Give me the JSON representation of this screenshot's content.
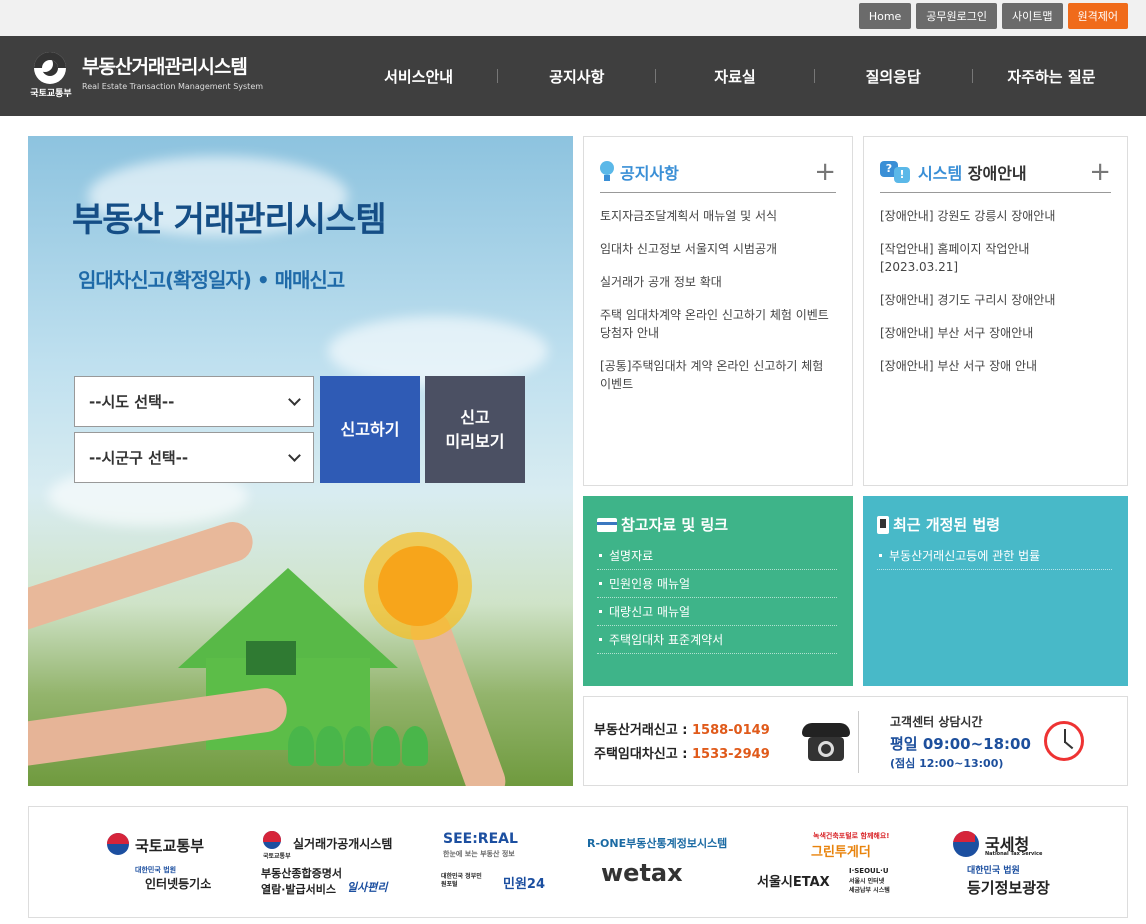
{
  "util_bar": {
    "home": "Home",
    "official_login": "공무원로그인",
    "sitemap": "사이트맵",
    "remote_control": "원격제어"
  },
  "header": {
    "ministry": "국토교통부",
    "title_ko": "부동산거래관리시스템",
    "title_en": "Real Estate Transaction Management System",
    "nav": [
      "서비스안내",
      "공지사항",
      "자료실",
      "질의응답",
      "자주하는 질문"
    ]
  },
  "hero": {
    "title": "부동산 거래관리시스템",
    "subtitle": "임대차신고(확정일자) • 매매신고",
    "sido_select": "--시도 선택--",
    "sigungu_select": "--시군구 선택--",
    "report_button": "신고하기",
    "preview_button": "신고\n미리보기"
  },
  "notice": {
    "title": "공지사항",
    "plus": "+",
    "items": [
      "토지자금조달계획서 매뉴얼 및 서식",
      "임대차 신고정보 서울지역 시범공개",
      "실거래가 공개 정보 확대",
      "주택 임대차계약 온라인 신고하기 체험 이벤트 당첨자 안내",
      "[공통]주택임대차 계약 온라인 신고하기 체험 이벤트"
    ]
  },
  "outage": {
    "title_a": "시스템",
    "title_b": "장애안내",
    "plus": "+",
    "items": [
      "[장애안내] 강원도 강릉시 장애안내",
      "[작업안내] 홈페이지 작업안내 [2023.03.21]",
      "[장애안내] 경기도 구리시 장애안내",
      "[장애안내] 부산 서구 장애안내",
      "[장애안내] 부산 서구 장애 안내"
    ]
  },
  "references": {
    "title": "참고자료 및 링크",
    "items": [
      "설명자료",
      "민원인용 매뉴얼",
      "대량신고 매뉴얼",
      "주택임대차 표준계약서"
    ]
  },
  "laws": {
    "title": "최근 개정된 법령",
    "items": [
      "부동산거래신고등에 관한 법률"
    ]
  },
  "contact": {
    "sale_label": "부동산거래신고 :",
    "sale_number": "1588-0149",
    "lease_label": "주택임대차신고 :",
    "lease_number": "1533-2949",
    "hours_title": "고객센터 상담시간",
    "hours": "평일 09:00~18:00",
    "lunch": "(점심 12:00~13:00)"
  },
  "banners": {
    "molit": "국토교통부",
    "iros": "인터넷등기소",
    "iros_sub": "대한민국 법원",
    "rtms": "실거래가공개시스템",
    "rtms_sub": "국토교통부",
    "cert_line1": "부동산종합증명서",
    "cert_line2": "열람·발급서비스",
    "cert_brand": "일사편리",
    "seereal": "SEE:REAL",
    "seereal_sub": "한눈에 보는 부동산 정보",
    "minwon_sub": "대한민국 정부민원포털",
    "minwon": "민원24",
    "rone": "R-ONE부동산통계정보시스템",
    "wetax": "wetax",
    "green_sub": "녹색건축포털로 함께해요!",
    "green": "그린투게더",
    "seoul_etax": "서울시ETAX",
    "seoul_sub1": "I·SEOUL·U",
    "seoul_sub2": "서울시 인터넷",
    "seoul_sub3": "세금납부 시스템",
    "nts": "국세청",
    "nts_sub": "National Tax Service",
    "court": "대한민국 법원",
    "registry": "등기정보광장"
  }
}
